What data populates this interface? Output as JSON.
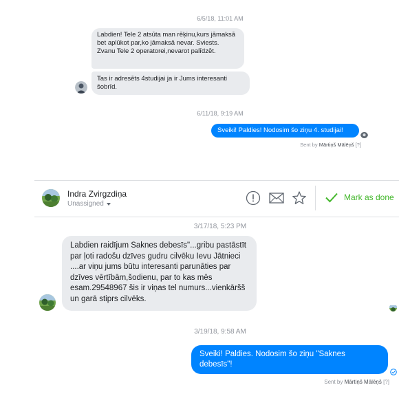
{
  "top": {
    "timestamp1": "6/5/18, 11:01 AM",
    "msg1": "Labdien! Tele 2 atsūta man rēķinu,kurs jāmaksā bet aplūkot par,ko jāmaksā nevar. Sviests. Zvanu Tele 2 operatorei,nevarot palīdzēt.",
    "msg2": "Tas ir adresēts 4studijai ja ir Jums interesanti šobrīd.",
    "timestamp2": "6/11/18, 9:19 AM",
    "reply": "Sveiki! Paldies! Nodosim šo ziņu 4. studijai!",
    "sent_by_prefix": "Sent by",
    "sent_by_name": "Mārtiņš Mālēņš",
    "sent_by_help": "[?]"
  },
  "header": {
    "contact_name": "Indra Zvirgzdiņa",
    "assignment": "Unassigned",
    "mark_done_label": "Mark as done"
  },
  "bottom": {
    "timestamp1": "3/17/18, 5:23 PM",
    "msg1": "Labdien raidījum Saknes debesīs\"...gribu pastāstīt par ļoti radošu dzīves gudru cilvēku Ievu Jātnieci ....ar viņu jums būtu interesanti parunāties par dzīves vērtībām,šodienu, par to kas mēs esam.29548967 šis ir viņas tel numurs...vienkāršš un garā stiprs cilvēks.",
    "timestamp2": "3/19/18, 9:58 AM",
    "reply": "Sveiki! Paldies. Nodosim šo ziņu \"Saknes debesīs\"!",
    "sent_by_prefix": "Sent by",
    "sent_by_name": "Mārtiņš Mālēņš",
    "sent_by_help": "[?]"
  },
  "colors": {
    "accent_blue": "#0084ff",
    "bubble_gray": "#e9ebee",
    "done_green": "#42b72a"
  }
}
